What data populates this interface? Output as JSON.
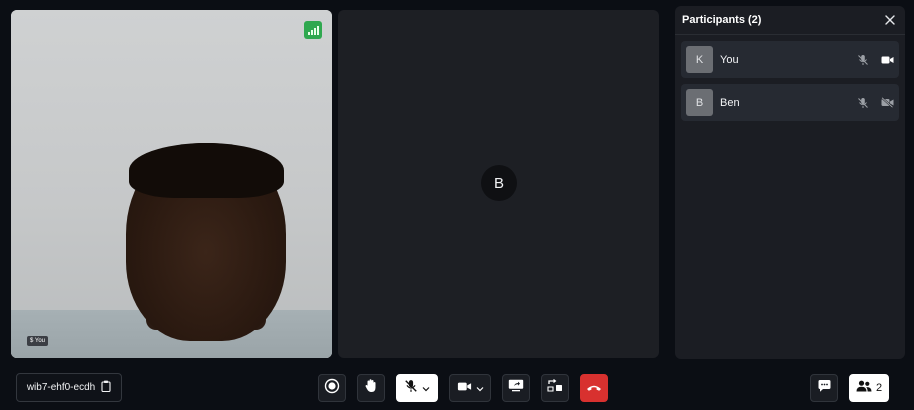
{
  "meeting": {
    "code": "wib7-ehf0-ecdh"
  },
  "self_tile": {
    "indicator": "$ You"
  },
  "remote_tile": {
    "initial": "B"
  },
  "participants_panel": {
    "title": "Participants (2)",
    "items": [
      {
        "initial": "K",
        "name": "You",
        "mic": "mic-muted-icon",
        "camera": "camera-on-icon"
      },
      {
        "initial": "B",
        "name": "Ben",
        "mic": "mic-muted-icon",
        "camera": "camera-off-icon"
      }
    ]
  },
  "toolbar": {
    "record": "record-icon",
    "raise_hand": "raise-hand-icon",
    "mic": "mic-muted-icon",
    "camera": "camera-icon",
    "share_screen": "share-screen-icon",
    "switch_layout": "switch-layout-icon",
    "end_call": "end-call-icon",
    "chat": "chat-icon",
    "people_count": "2"
  },
  "colors": {
    "accent_green": "#2fa84f",
    "end_call_red": "#d8312f",
    "background": "#0b0e14"
  }
}
